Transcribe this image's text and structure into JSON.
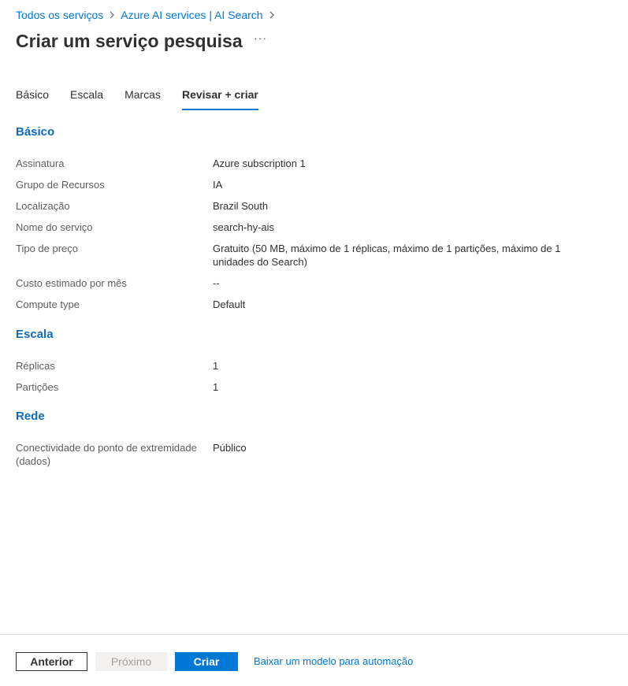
{
  "breadcrumb": {
    "items": [
      "Todos os serviços",
      "Azure AI services | AI Search"
    ]
  },
  "header": {
    "title": "Criar um serviço pesquisa",
    "more_label": "···"
  },
  "tabs": [
    {
      "label": "Básico"
    },
    {
      "label": "Escala"
    },
    {
      "label": "Marcas"
    },
    {
      "label": "Revisar + criar",
      "active": true
    }
  ],
  "sections": {
    "basico": {
      "title": "Básico",
      "rows": [
        {
          "label": "Assinatura",
          "value": "Azure subscription 1"
        },
        {
          "label": "Grupo de Recursos",
          "value": "IA"
        },
        {
          "label": "Localização",
          "value": "Brazil South"
        },
        {
          "label": "Nome do serviço",
          "value": "search-hy-ais"
        },
        {
          "label": "Tipo de preço",
          "value": "Gratuito (50 MB, máximo de 1 réplicas, máximo de 1 partições, máximo de 1 unidades do Search)"
        },
        {
          "label": "Custo estimado por mês",
          "value": "--"
        },
        {
          "label": "Compute type",
          "value": "Default"
        }
      ]
    },
    "escala": {
      "title": "Escala",
      "rows": [
        {
          "label": "Réplicas",
          "value": "1"
        },
        {
          "label": "Partições",
          "value": "1"
        }
      ]
    },
    "rede": {
      "title": "Rede",
      "rows": [
        {
          "label": "Conectividade do ponto de extremidade (dados)",
          "value": "Público"
        }
      ]
    }
  },
  "footer": {
    "previous_label": "Anterior",
    "next_label": "Próximo",
    "create_label": "Criar",
    "template_link": "Baixar um modelo para automação"
  },
  "colors": {
    "accent": "#0078d4",
    "section_title": "#0f6cbd",
    "disabled_bg": "#f3f2f1"
  }
}
